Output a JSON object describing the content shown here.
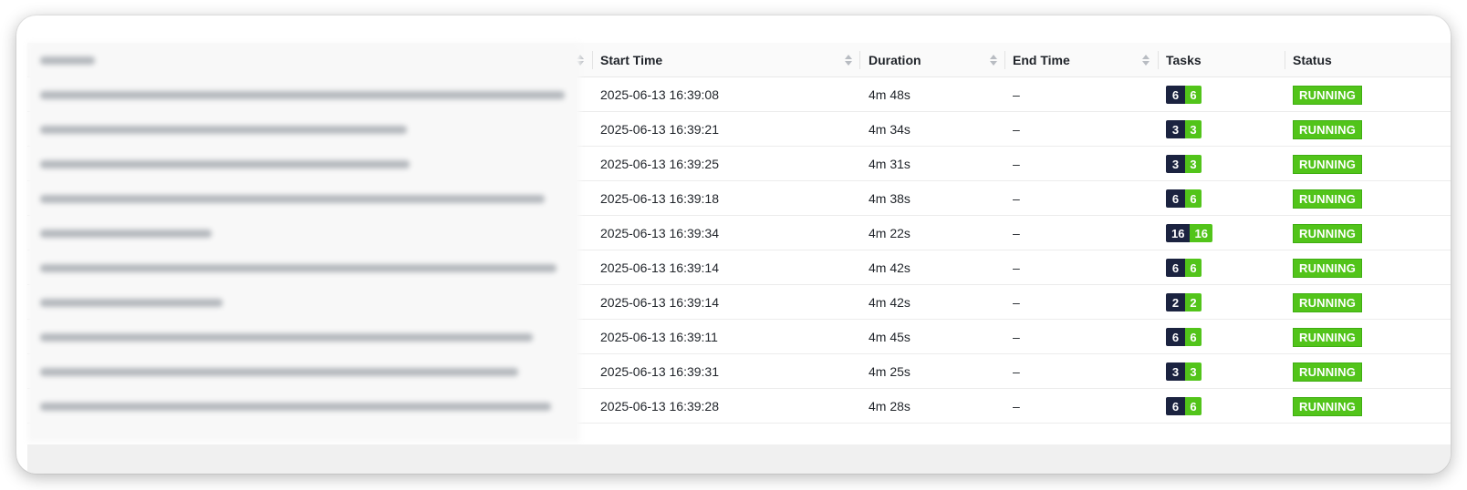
{
  "table": {
    "columns": {
      "name": "",
      "start_time": "Start Time",
      "duration": "Duration",
      "end_time": "End Time",
      "tasks": "Tasks",
      "status": "Status"
    },
    "rows": [
      {
        "start": "2025-06-13 16:39:08",
        "duration": "4m 48s",
        "end": "–",
        "tasks_a": "6",
        "tasks_b": "6",
        "status": "RUNNING"
      },
      {
        "start": "2025-06-13 16:39:21",
        "duration": "4m 34s",
        "end": "–",
        "tasks_a": "3",
        "tasks_b": "3",
        "status": "RUNNING"
      },
      {
        "start": "2025-06-13 16:39:25",
        "duration": "4m 31s",
        "end": "–",
        "tasks_a": "3",
        "tasks_b": "3",
        "status": "RUNNING"
      },
      {
        "start": "2025-06-13 16:39:18",
        "duration": "4m 38s",
        "end": "–",
        "tasks_a": "6",
        "tasks_b": "6",
        "status": "RUNNING"
      },
      {
        "start": "2025-06-13 16:39:34",
        "duration": "4m 22s",
        "end": "–",
        "tasks_a": "16",
        "tasks_b": "16",
        "status": "RUNNING"
      },
      {
        "start": "2025-06-13 16:39:14",
        "duration": "4m 42s",
        "end": "–",
        "tasks_a": "6",
        "tasks_b": "6",
        "status": "RUNNING"
      },
      {
        "start": "2025-06-13 16:39:14",
        "duration": "4m 42s",
        "end": "–",
        "tasks_a": "2",
        "tasks_b": "2",
        "status": "RUNNING"
      },
      {
        "start": "2025-06-13 16:39:11",
        "duration": "4m 45s",
        "end": "–",
        "tasks_a": "6",
        "tasks_b": "6",
        "status": "RUNNING"
      },
      {
        "start": "2025-06-13 16:39:31",
        "duration": "4m 25s",
        "end": "–",
        "tasks_a": "3",
        "tasks_b": "3",
        "status": "RUNNING"
      },
      {
        "start": "2025-06-13 16:39:28",
        "duration": "4m 28s",
        "end": "–",
        "tasks_a": "6",
        "tasks_b": "6",
        "status": "RUNNING"
      }
    ]
  },
  "colors": {
    "running_green": "#52c41a",
    "tasks_dark": "#1b2340",
    "header_bg": "#fafafa"
  },
  "icons": {
    "sort": "sort-icon"
  }
}
